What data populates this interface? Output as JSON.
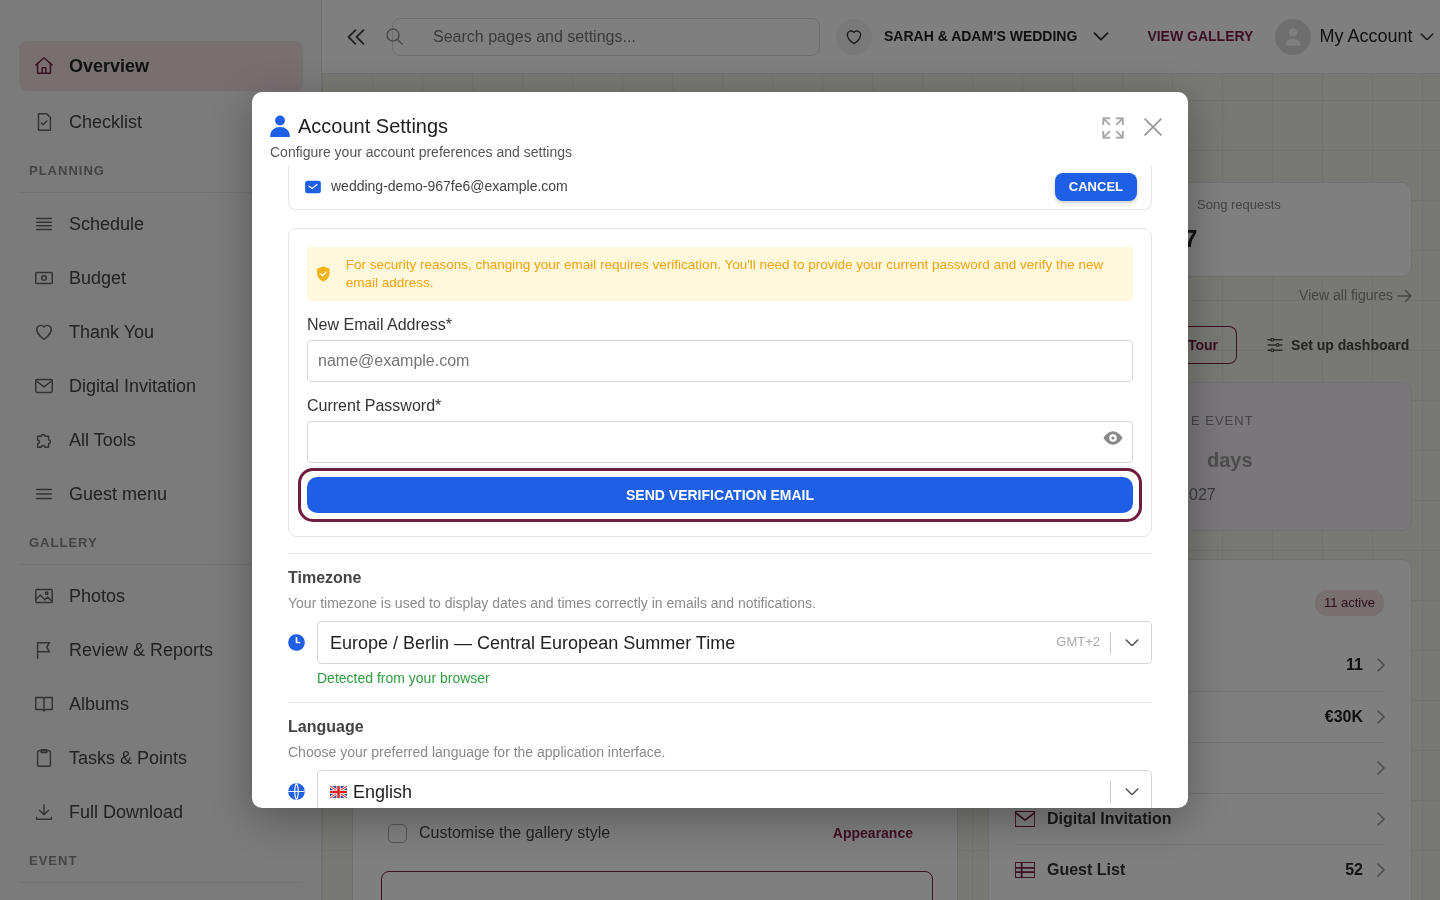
{
  "sidebar": {
    "items": [
      {
        "kind": "link",
        "label": "Overview",
        "selected": true
      },
      {
        "kind": "link",
        "label": "Checklist",
        "selected": false
      },
      {
        "kind": "heading",
        "label": "PLANNING"
      },
      {
        "kind": "link",
        "label": "Schedule",
        "selected": false
      },
      {
        "kind": "link",
        "label": "Budget",
        "selected": false
      },
      {
        "kind": "link",
        "label": "Thank You",
        "selected": false
      },
      {
        "kind": "link",
        "label": "Digital Invitation",
        "selected": false
      },
      {
        "kind": "link",
        "label": "All Tools",
        "selected": false
      },
      {
        "kind": "link",
        "label": "Guest menu",
        "selected": false
      },
      {
        "kind": "heading",
        "label": "GALLERY"
      },
      {
        "kind": "link",
        "label": "Photos",
        "selected": false
      },
      {
        "kind": "link",
        "label": "Review & Reports",
        "selected": false
      },
      {
        "kind": "link",
        "label": "Albums",
        "selected": false
      },
      {
        "kind": "link",
        "label": "Tasks & Points",
        "selected": false
      },
      {
        "kind": "link",
        "label": "Full Download",
        "selected": false
      },
      {
        "kind": "heading",
        "label": "EVENT"
      }
    ]
  },
  "topbar": {
    "search": {
      "placeholder": "Search pages and settings..."
    },
    "event_name": "SARAH & ADAM'S WEDDING",
    "view_gallery": "VIEW GALLERY",
    "account": "My Account"
  },
  "dashboard": {
    "song_requests": {
      "label": "Song requests",
      "value": "7"
    },
    "view_all": "View all figures",
    "tour_button": "Tour",
    "setup_button": "Set up dashboard",
    "countdown": {
      "label": "E EVENT",
      "unit": "days",
      "date": "027"
    },
    "tools": {
      "badge": "11 active",
      "rows": [
        {
          "kind": "value",
          "value": "11"
        },
        {
          "kind": "value",
          "value": "€30K"
        },
        {
          "kind": "blank"
        },
        {
          "kind": "label",
          "label": "Digital Invitation"
        },
        {
          "kind": "both",
          "label": "Guest List",
          "value": "52"
        }
      ]
    },
    "task": {
      "label": "Customise the gallery style",
      "checked": false,
      "link": "Appearance"
    }
  },
  "modal": {
    "title": "Account Settings",
    "subtitle": "Configure your account preferences and settings",
    "current_email": "wedding-demo-967fe6@example.com",
    "cancel_button": "CANCEL",
    "notice": "For security reasons, changing your email requires verification. You'll need to provide your current password and verify the new email address.",
    "new_email": {
      "label": "New Email Address*",
      "placeholder": "name@example.com"
    },
    "password": {
      "label": "Current Password*"
    },
    "send_button": {
      "label": "SEND VERIFICATION EMAIL",
      "focused": true
    },
    "timezone": {
      "heading": "Timezone",
      "description": "Your timezone is used to display dates and times correctly in emails and notifications.",
      "value": "Europe / Berlin — Central European Summer Time",
      "offset": "GMT+2",
      "hint": "Detected from your browser"
    },
    "language": {
      "heading": "Language",
      "description": "Choose your preferred language for the application interface.",
      "value": "English"
    }
  }
}
